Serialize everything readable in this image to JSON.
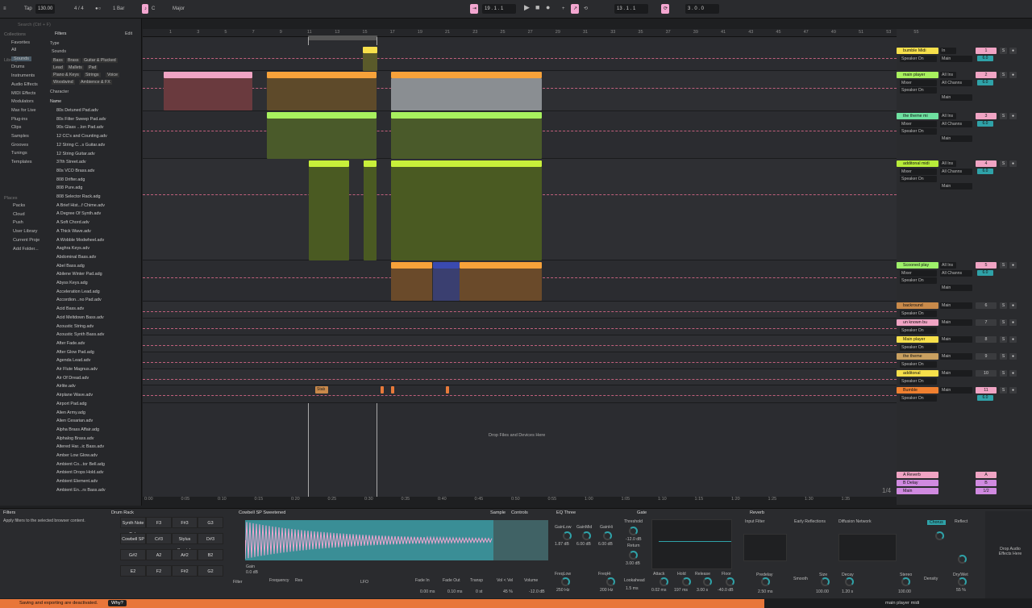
{
  "topbar": {
    "tap": "Tap",
    "tempo": "130.00",
    "meter": "4 / 4",
    "metro": "1 Bar",
    "key": "C",
    "scale": "Major",
    "pos": "19 . 1 . 1",
    "loop_start": "13 . 1 . 1",
    "loop_len": "3 . 0 . 0"
  },
  "browser": {
    "search": "Search (Ctrl + F)",
    "collections": "Collections",
    "favorites": "Favorites",
    "library": "Library",
    "lib_items": [
      "All",
      "Sounds",
      "Drums",
      "Instruments",
      "Audio Effects",
      "MIDI Effects",
      "Modulators",
      "Max for Live",
      "Plug-ins",
      "Clips",
      "Samples",
      "Grooves",
      "Tunings",
      "Templates"
    ],
    "places": "Places",
    "place_items": [
      "Packs",
      "Cloud",
      "Push",
      "User Library",
      "Current Proje",
      "Add Folder..."
    ],
    "filters": "Filters",
    "edit": "Edit",
    "type": "Type",
    "sounds": "Sounds",
    "tags": [
      "Bass",
      "Brass",
      "Guitar & Plucked",
      "Lead",
      "Mallets",
      "Pad",
      "Piano & Keys",
      "Strings",
      "Voice",
      "Woodwind",
      "Ambience & FX"
    ],
    "character": "Character",
    "name_col": "Name",
    "files": [
      "80s Detuned Pad.adv",
      "80s Filter Sweep Pad.adv",
      "90s Glass ...lon Pad.adv",
      "12 CC's and Counting.adv",
      "12 String C...s Guitar.adv",
      "12 String Guitar.adv",
      "37th Street.adv",
      "80s VCO Brass.adv",
      "808 Drifter.adg",
      "808 Pure.adg",
      "808 Selector Rack.adg",
      "A Brief Hist...f Chime.adv",
      "A Degree Of Synth.adv",
      "A Soft Chord.adv",
      "A Thick Wave.adv",
      "A Wobble Modwheel.adv",
      "Aaghra Keys.adv",
      "Abdominal Bass.adv",
      "Abel Bass.adg",
      "Abilene Winter Pad.adg",
      "Abyss Keys.adg",
      "Acceleration Lead.adg",
      "Accordion...no Pad.adv",
      "Acid Bass.adv",
      "Acid Meltdown Bass.adv",
      "Acoustic String.adv",
      "Acoustic Synth Bass.adv",
      "After Fade.adv",
      "After Glow Pad.adg",
      "Agenda Lead.adv",
      "Air Flute Magnus.adv",
      "Air Of Dread.adv",
      "Airlite.adv",
      "Airplane Wave.adv",
      "Airport Pad.adg",
      "Alien Army.adg",
      "Alien Cesarian.adv",
      "Alpha Brass Affair.adg",
      "Alphalog Brass.adv",
      "Altered Har...ic Bass.adv",
      "Amber Low Glow.adv",
      "Ambient Co...tor Bell.adg",
      "Ambient Drops Hold.adv",
      "Ambient Element.adv",
      "Ambient En...rs Bass.adv"
    ]
  },
  "ruler": [
    "1",
    "3",
    "5",
    "7",
    "9",
    "11",
    "13",
    "15",
    "17",
    "19",
    "21",
    "23",
    "25",
    "27",
    "29",
    "31",
    "33",
    "35",
    "37",
    "39",
    "41",
    "43",
    "45",
    "47",
    "49",
    "51",
    "53",
    "55"
  ],
  "timeline": [
    "0:00",
    "0:05",
    "0:10",
    "0:15",
    "0:20",
    "0:25",
    "0:30",
    "0:35",
    "0:40",
    "0:45",
    "0:50",
    "0:55",
    "1:00",
    "1:05",
    "1:10",
    "1:15",
    "1:20",
    "1:25",
    "1:30",
    "1:35"
  ],
  "clips": {
    "stab": "Stab",
    "drop_hint": "Drop Files and Devices Here",
    "zoom": "1/4"
  },
  "tracks": [
    {
      "name": "bumble Midi",
      "col": "#f7e04b",
      "in": "In",
      "auto": "Auto",
      "off": "Off",
      "num": "1",
      "vol": "6.0",
      "out1": "Speaker On",
      "out2": "Main"
    },
    {
      "name": "main player",
      "col": "#a8f05e",
      "in": "All Ins",
      "auto": "",
      "off": "",
      "num": "2",
      "vol": "6.0",
      "out1": "Mixer",
      "out2": "All Channs",
      "out3": "Speaker On",
      "out4": "Main"
    },
    {
      "name": "the theme mi",
      "col": "#6ee0a0",
      "in": "All Ins",
      "num": "3",
      "vol": "6.0",
      "out1": "Mixer",
      "out2": "All Channs",
      "out3": "Speaker On",
      "out4": "Main"
    },
    {
      "name": "additonal midi",
      "col": "#b8ec3a",
      "in": "All Ins",
      "num": "4",
      "vol": "6.0",
      "out1": "Mixer",
      "out2": "All Channs",
      "out3": "Speaker On",
      "out4": "Main"
    },
    {
      "name": "Scooned play",
      "col": "#9ef06a",
      "in": "All Ins",
      "num": "5",
      "vol": "6.0",
      "out1": "Mixer",
      "out2": "All Channs",
      "out3": "Speaker On",
      "out4": "Main"
    },
    {
      "name": "backround",
      "col": "#c98a4a",
      "num": "6",
      "out1": "Speaker On",
      "out2": "Main"
    },
    {
      "name": "un known bu",
      "col": "#f0a4c4",
      "num": "7",
      "out1": "Speaker On",
      "out2": "Main"
    },
    {
      "name": "Main player",
      "col": "#f7e04b",
      "num": "8",
      "out1": "Speaker On",
      "out2": "Main"
    },
    {
      "name": "the theme",
      "col": "#c9a060",
      "num": "9",
      "out1": "Speaker On",
      "out2": "Main"
    },
    {
      "name": "additonal",
      "col": "#f7e04b",
      "num": "10",
      "out1": "Speaker On",
      "out2": "Main"
    },
    {
      "name": "Bumble",
      "col": "#f08030",
      "num": "11",
      "vol": "6.0",
      "out1": "Speaker On",
      "out2": "Main"
    }
  ],
  "returns": [
    {
      "name": "A Reverb",
      "num": "A",
      "col": "#f0a4c4"
    },
    {
      "name": "B Delay",
      "num": "B",
      "col": "#d08ae0"
    },
    {
      "name": "Main",
      "num": "1/2",
      "col": "#d08ae0"
    }
  ],
  "devices": {
    "filters": "Filters",
    "filters_desc": "Apply filters to the selected browser content.",
    "drum_rack": "Drum Rack",
    "pads": [
      "Synth Note Pok",
      "F3",
      "F#3",
      "G3",
      "Cowbell SP",
      "C#3",
      "Stylus Scratch",
      "D#3",
      "G#2",
      "A2",
      "A#2",
      "B2",
      "E2",
      "F2",
      "F#2",
      "G2"
    ],
    "sampler": "Cowbell SP Sweetened",
    "sample_tab": "Sample",
    "controls_tab": "Controls",
    "gain": "0.0 dB",
    "filter": "Filter",
    "freq": "Frequency",
    "res": "Res",
    "lfo": "LFO",
    "fade_in": "Fade In",
    "fade_out": "Fade Out",
    "transp": "Transp",
    "vol_vel": "Vol < Vel",
    "volume": "Volume",
    "fade_in_v": "0.00 ms",
    "fade_out_v": "0.10 ms",
    "transp_v": "0 st",
    "vel_v": "45 %",
    "vol_v": "-12.0 dB",
    "eq": "EQ Three",
    "gainlow": "GainLow",
    "gainmid": "GainMid",
    "gainhi": "GainHi",
    "gl": "1.87 dB",
    "gm": "6.00 dB",
    "gh": "6.00 dB",
    "freqlow": "FreqLow",
    "freqhi": "FreqHi",
    "fl": "250 Hz",
    "fh": "200 Hz",
    "gate": "Gate",
    "threshold": "Threshold",
    "thr_v": "-12.0 dB",
    "return": "Return",
    "ret_v": "3.00 dB",
    "lookahead": "Lookahead",
    "la_v": "1.5 ms",
    "attack": "Attack",
    "hold": "Hold",
    "release": "Release",
    "floor": "Floor",
    "att_v": "0.02 ms",
    "hold_v": "197 ms",
    "rel_v": "3.00 s",
    "floor_v": "-40.0 dB",
    "reverb": "Reverb",
    "input_filter": "Input Filter",
    "early": "Early Reflections",
    "diffusion": "Diffusion Network",
    "chorus": "Chorus",
    "reflect": "Reflect",
    "predelay": "Predelay",
    "pd_v": "2.50 ms",
    "smooth": "Smooth",
    "size": "Size",
    "size_v": "100.00",
    "decay": "Decay",
    "decay_v": "1.20 s",
    "stereo": "Stereo",
    "stereo_v": "100.00",
    "density": "Density",
    "drywet": "Dry/Wet",
    "dw_v": "55 %",
    "drop_audio": "Drop Audio Effects Here"
  },
  "status": {
    "msg": "Saving and exporting are deactivated.",
    "why": "Why?",
    "track": "main player midi"
  }
}
